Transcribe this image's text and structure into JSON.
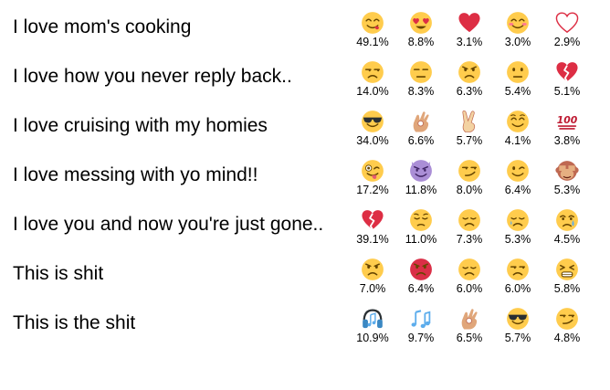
{
  "rows": [
    {
      "sentence": "I love mom's cooking",
      "emojis": [
        {
          "icon": "face-savoring-food-icon",
          "percent": "49.1%"
        },
        {
          "icon": "heart-eyes-face-icon",
          "percent": "8.8%"
        },
        {
          "icon": "red-heart-icon",
          "percent": "3.1%"
        },
        {
          "icon": "smiling-face-with-smiling-eyes-icon",
          "percent": "3.0%"
        },
        {
          "icon": "white-heart-outline-icon",
          "percent": "2.9%"
        }
      ]
    },
    {
      "sentence": "I love how you never reply back..",
      "emojis": [
        {
          "icon": "unamused-face-icon",
          "percent": "14.0%"
        },
        {
          "icon": "expressionless-face-icon",
          "percent": "8.3%"
        },
        {
          "icon": "angry-face-icon",
          "percent": "6.3%"
        },
        {
          "icon": "neutral-face-icon",
          "percent": "5.4%"
        },
        {
          "icon": "broken-heart-icon",
          "percent": "5.1%"
        }
      ]
    },
    {
      "sentence": "I love cruising with my homies",
      "emojis": [
        {
          "icon": "smiling-face-with-sunglasses-icon",
          "percent": "34.0%"
        },
        {
          "icon": "ok-hand-icon",
          "percent": "6.6%"
        },
        {
          "icon": "victory-hand-icon",
          "percent": "5.7%"
        },
        {
          "icon": "relieved-face-icon",
          "percent": "4.1%"
        },
        {
          "icon": "hundred-points-icon",
          "percent": "3.8%"
        }
      ]
    },
    {
      "sentence": "I love messing with yo mind!!",
      "emojis": [
        {
          "icon": "winking-face-with-tongue-icon",
          "percent": "17.2%"
        },
        {
          "icon": "smiling-face-with-horns-icon",
          "percent": "11.8%"
        },
        {
          "icon": "smirking-face-icon",
          "percent": "8.0%"
        },
        {
          "icon": "winking-face-icon",
          "percent": "6.4%"
        },
        {
          "icon": "see-no-evil-monkey-icon",
          "percent": "5.3%"
        }
      ]
    },
    {
      "sentence": "I love you and now you're just gone..",
      "emojis": [
        {
          "icon": "broken-heart-icon",
          "percent": "39.1%"
        },
        {
          "icon": "pensive-face-icon",
          "percent": "11.0%"
        },
        {
          "icon": "disappointed-face-icon",
          "percent": "7.3%"
        },
        {
          "icon": "sleepy-face-icon",
          "percent": "5.3%"
        },
        {
          "icon": "crying-face-icon",
          "percent": "4.5%"
        }
      ]
    },
    {
      "sentence": "This is shit",
      "emojis": [
        {
          "icon": "angry-face-icon",
          "percent": "7.0%"
        },
        {
          "icon": "pouting-face-icon",
          "percent": "6.4%"
        },
        {
          "icon": "disappointed-face-icon",
          "percent": "6.0%"
        },
        {
          "icon": "unamused-face-icon",
          "percent": "6.0%"
        },
        {
          "icon": "persevering-face-icon",
          "percent": "5.8%"
        }
      ]
    },
    {
      "sentence": "This is the shit",
      "emojis": [
        {
          "icon": "headphone-icon",
          "percent": "10.9%"
        },
        {
          "icon": "musical-notes-icon",
          "percent": "9.7%"
        },
        {
          "icon": "ok-hand-icon",
          "percent": "6.5%"
        },
        {
          "icon": "smiling-face-with-sunglasses-icon",
          "percent": "5.7%"
        },
        {
          "icon": "smirking-face-icon",
          "percent": "4.8%"
        }
      ]
    }
  ],
  "colors": {
    "face_yellow": "#FFCC4D",
    "face_feature": "#664500",
    "heart_red": "#DD2E44",
    "pouting_red": "#DA2F47",
    "purple": "#AA8ED6",
    "skin": "#E0A67A",
    "music_blue": "#5DADEC",
    "headphone_blue": "#3B88C3",
    "monkey_brown": "#BF6952",
    "text": "#000000"
  }
}
